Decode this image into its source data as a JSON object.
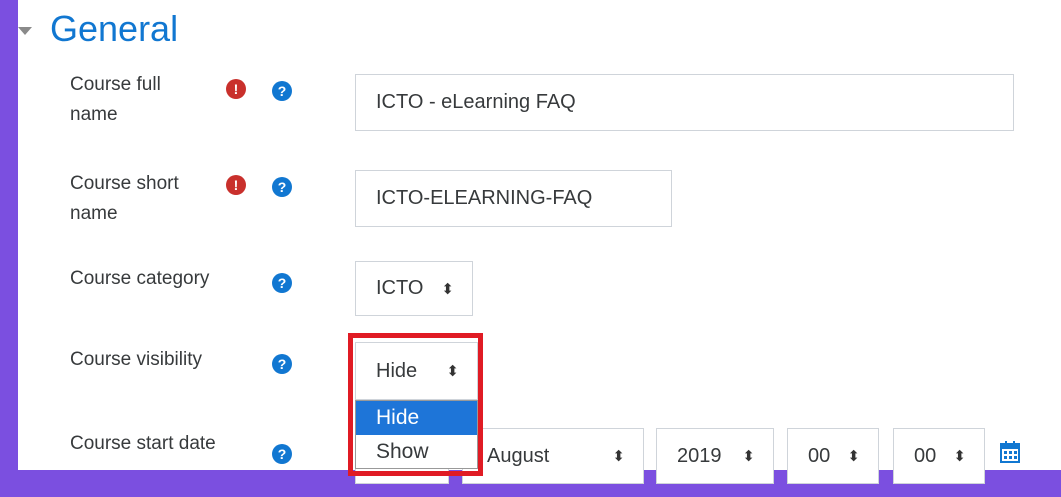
{
  "section": {
    "title": "General"
  },
  "fields": {
    "full_name": {
      "label_line1": "Course full",
      "label_line2": "name",
      "value": "ICTO - eLearning FAQ"
    },
    "short_name": {
      "label_line1": "Course short",
      "label_line2": "name",
      "value": "ICTO-ELEARNING-FAQ"
    },
    "category": {
      "label": "Course category",
      "value": "ICTO"
    },
    "visibility": {
      "label": "Course visibility",
      "value": "Hide",
      "options": [
        "Hide",
        "Show"
      ]
    },
    "start_date": {
      "label": "Course start date",
      "month": "August",
      "year": "2019",
      "hour": "00",
      "minute": "00"
    }
  },
  "icons": {
    "required": "!",
    "help": "?",
    "select_arrows": "⬍"
  },
  "colors": {
    "background": "#7b4fe0",
    "title": "#1177d1",
    "required": "#c9302c",
    "help": "#1177d1",
    "highlight": "#e01b24",
    "selected_option": "#1e75d8"
  }
}
